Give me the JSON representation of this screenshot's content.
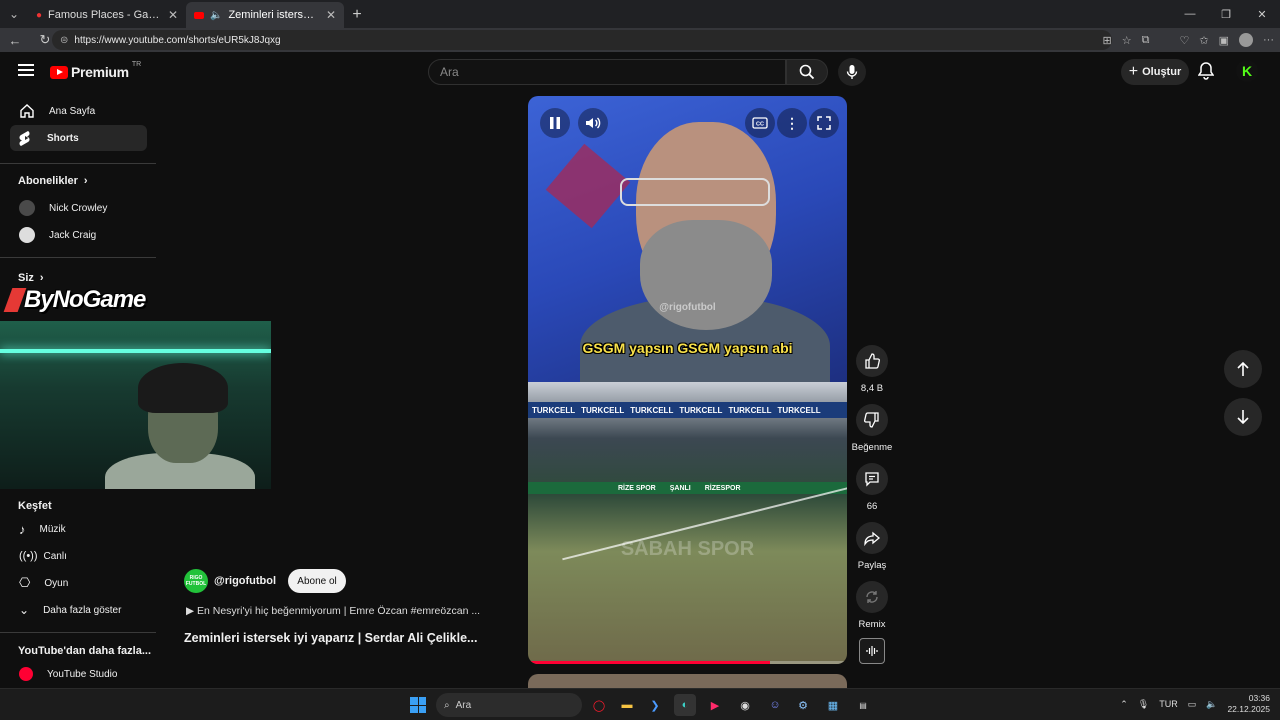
{
  "browser": {
    "tabs": [
      {
        "title": "Famous Places - Game - GeoGuessr",
        "active": false
      },
      {
        "title": "Zeminleri istersek iyi yaparız | Serdar Ali Çelikler",
        "active": true
      }
    ],
    "url": "https://www.youtube.com/shorts/eUR5kJ8Jqxg"
  },
  "header": {
    "logo_text": "Premium",
    "region": "TR",
    "search_placeholder": "Ara",
    "create_label": "Oluştur"
  },
  "sidebar": {
    "main": [
      {
        "label": "Ana Sayfa",
        "icon": "home-icon"
      },
      {
        "label": "Shorts",
        "icon": "shorts-icon",
        "active": true
      }
    ],
    "subscriptions_title": "Abonelikler",
    "subscriptions": [
      {
        "label": "Nick Crowley"
      },
      {
        "label": "Jack Craig"
      }
    ],
    "you_title": "Siz",
    "explore_title": "Keşfet",
    "explore": [
      {
        "label": "Müzik",
        "icon": "music-icon"
      },
      {
        "label": "Canlı",
        "icon": "live-icon"
      },
      {
        "label": "Oyun",
        "icon": "gaming-icon"
      },
      {
        "label": "Daha fazla göster",
        "icon": "chevron-down-icon"
      }
    ],
    "more_title": "YouTube'dan daha fazla...",
    "more": [
      {
        "label": "YouTube Studio"
      }
    ]
  },
  "overlay": {
    "logo_text": "ByNoGame"
  },
  "short": {
    "channel_logo_text": "RIGO FUTBOL",
    "channel": "@rigofutbol",
    "subscribe_label": "Abone ol",
    "song": "En Nesyri'yi hiç beğenmiyorum | Emre Özcan #emreözcan ...",
    "song_prefix": "▶",
    "title": "Zeminleri istersek iyi yaparız | Serdar Ali Çelikle...",
    "caption": "GSGM yapsın GSGM yapsın abi",
    "watermark": "@rigofutbol",
    "stadium_banner": [
      "TURKCELL",
      "TURKCELL",
      "TURKCELL",
      "TURKCELL",
      "TURKCELL",
      "TURKCELL"
    ],
    "stadium_ads": [
      "RİZE SPOR",
      "ŞANLI",
      "RİZESPOR"
    ],
    "stadium_watermark": "SABAH SPOR",
    "progress": 0.76
  },
  "actions": {
    "likes": "8,4 B",
    "dislike_label": "Beğenme",
    "comments": "66",
    "share_label": "Paylaş",
    "remix_label": "Remix"
  },
  "taskbar": {
    "search_placeholder": "Ara",
    "lang": "TUR",
    "time": "03:36",
    "date": "22.12.2025"
  },
  "colors": {
    "accent": "#ff0000",
    "kick_green": "#53fc18",
    "caption_yellow": "#f8e14a"
  }
}
